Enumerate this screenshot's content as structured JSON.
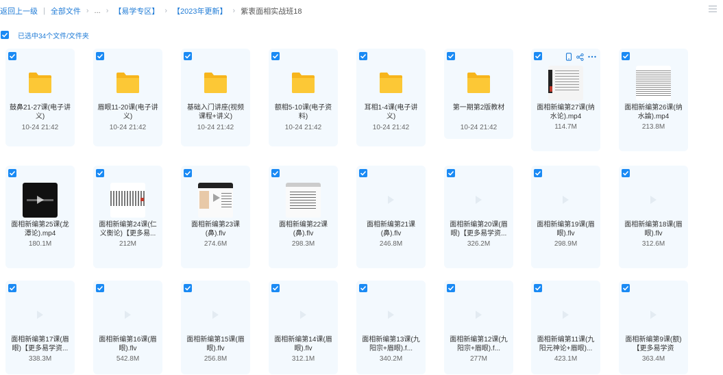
{
  "breadcrumb": {
    "back": "返回上一级",
    "items": [
      "全部文件",
      "...",
      "【易学专区】",
      "【2023年更新】"
    ],
    "current": "紫衷面相实战班18"
  },
  "selection": {
    "label": "已选中34个文件/文件夹"
  },
  "colors": {
    "accent": "#1a8af4",
    "card_bg": "#f3f9fe",
    "folder": "#fcc02d"
  },
  "files": [
    {
      "name": "鼓鼻21-27课(电子讲义)",
      "meta": "10-24 21:42",
      "kind": "folder"
    },
    {
      "name": "眉眼11-20课(电子讲义)",
      "meta": "10-24 21:42",
      "kind": "folder"
    },
    {
      "name": "基础入门讲座(视频课程+讲义)",
      "meta": "10-24 21:42",
      "kind": "folder"
    },
    {
      "name": "额相5-10课(电子资料)",
      "meta": "10-24 21:42",
      "kind": "folder"
    },
    {
      "name": "耳相1-4课(电子讲义)",
      "meta": "10-24 21:42",
      "kind": "folder"
    },
    {
      "name": "第一期第2版教材",
      "meta": "10-24 21:42",
      "kind": "folder"
    },
    {
      "name": "面相新编第27课(纳水论).mp4",
      "meta": "114.7M",
      "kind": "video-thumb-a"
    },
    {
      "name": "面相新编第26课(纳水論).mp4",
      "meta": "213.8M",
      "kind": "video-thumb-b"
    },
    {
      "name": "面相新编第25课(龙潭论).mp4",
      "meta": "180.1M",
      "kind": "video-thumb-dark"
    },
    {
      "name": "面相新编第24课(仁义衡论)【更多易...",
      "meta": "212M",
      "kind": "video-thumb-c"
    },
    {
      "name": "面相新编第23课(鼻).flv",
      "meta": "274.6M",
      "kind": "video-thumb-d"
    },
    {
      "name": "面相新编第22课(鼻).flv",
      "meta": "298.3M",
      "kind": "video-thumb-e"
    },
    {
      "name": "面相新编第21课(鼻).flv",
      "meta": "246.8M",
      "kind": "video"
    },
    {
      "name": "面相新编第20课(眉眼)【更多易学资...",
      "meta": "326.2M",
      "kind": "video"
    },
    {
      "name": "面相新编第19课(眉眼).flv",
      "meta": "298.9M",
      "kind": "video"
    },
    {
      "name": "面相新编第18课(眉眼).flv",
      "meta": "312.6M",
      "kind": "video"
    },
    {
      "name": "面相新编第17课(眉眼)【更多易学资...",
      "meta": "338.3M",
      "kind": "video"
    },
    {
      "name": "面相新编第16课(眉眼).flv",
      "meta": "542.8M",
      "kind": "video"
    },
    {
      "name": "面相新编第15课(眉眼).flv",
      "meta": "256.8M",
      "kind": "video"
    },
    {
      "name": "面相新编第14课(眉眼).flv",
      "meta": "312.1M",
      "kind": "video"
    },
    {
      "name": "面相新编第13课(九阳宗+眉眼).f...",
      "meta": "340.2M",
      "kind": "video"
    },
    {
      "name": "面相新编第12课(九阳宗+眉眼).f...",
      "meta": "277M",
      "kind": "video"
    },
    {
      "name": "面相新编第11课(九阳元神论+眉眼)...",
      "meta": "423.1M",
      "kind": "video"
    },
    {
      "name": "面相新编第9课(额)【更多易学资",
      "meta": "363.4M",
      "kind": "video"
    }
  ]
}
